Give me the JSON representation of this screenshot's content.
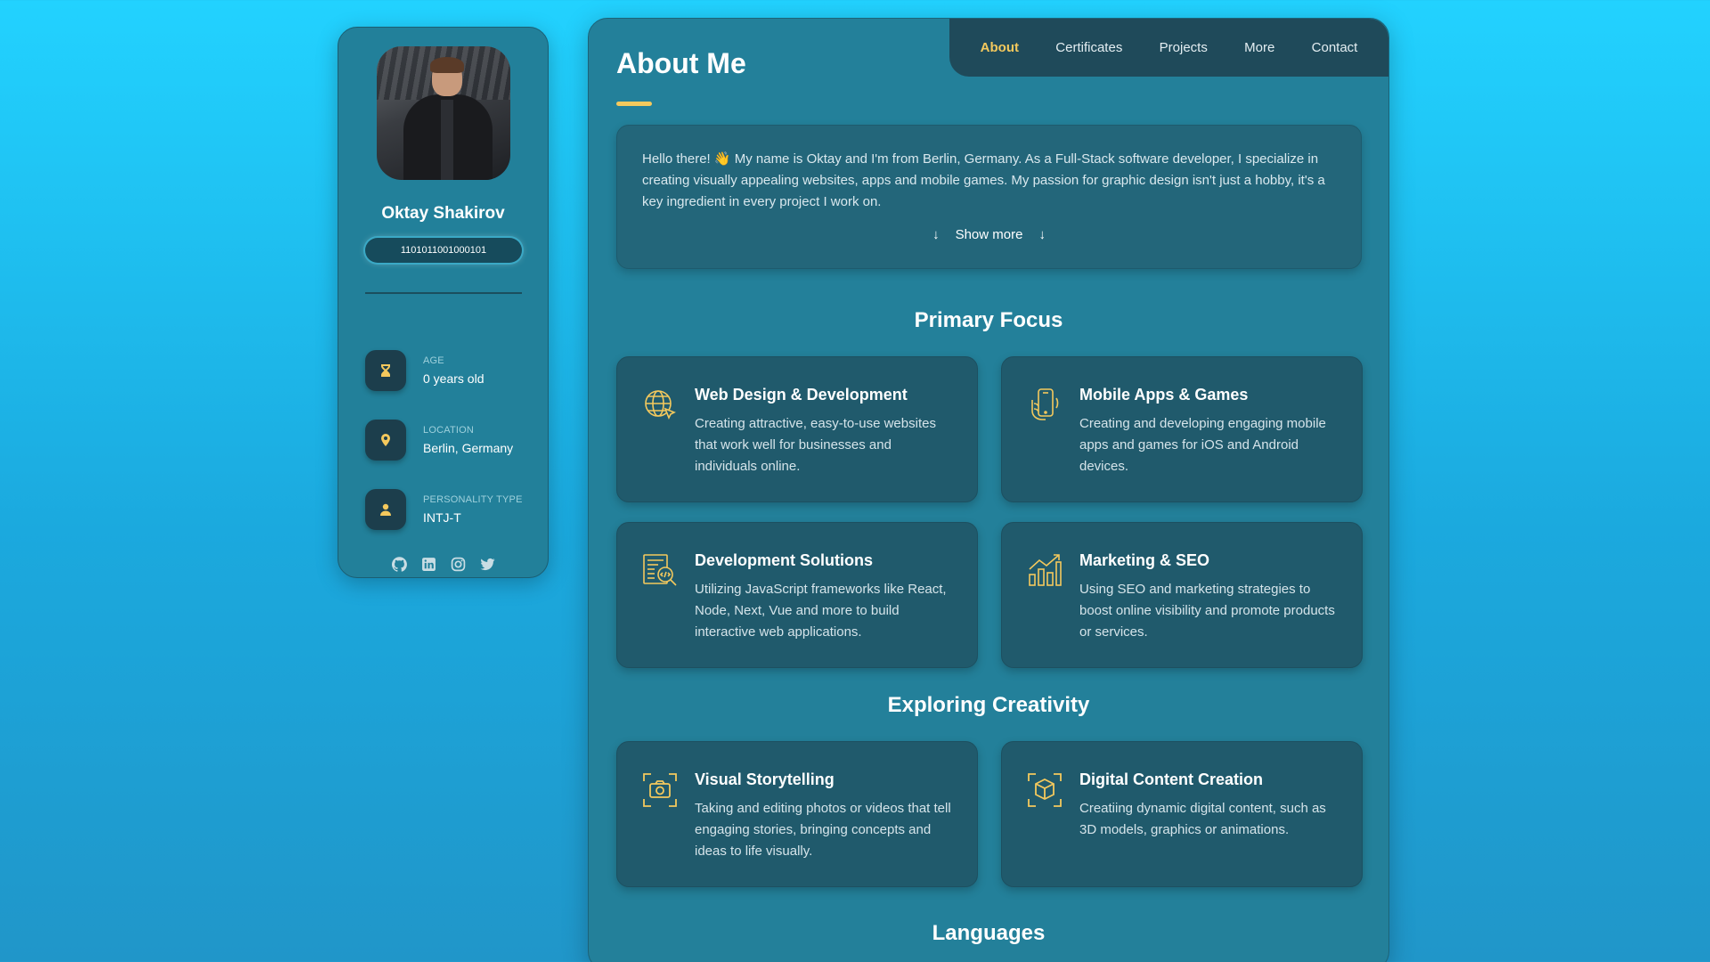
{
  "profile": {
    "name": "Oktay Shakirov",
    "binary": "1101011001000101",
    "info": [
      {
        "label": "Age",
        "value": "0 years old",
        "icon": "hourglass-icon"
      },
      {
        "label": "Location",
        "value": "Berlin, Germany",
        "icon": "location-pin-icon"
      },
      {
        "label": "Personality Type",
        "value": "INTJ-T",
        "icon": "person-icon"
      }
    ],
    "socials": [
      "github-icon",
      "linkedin-icon",
      "instagram-icon",
      "twitter-icon"
    ]
  },
  "nav": {
    "items": [
      "About",
      "Certificates",
      "Projects",
      "More",
      "Contact"
    ],
    "active": "About"
  },
  "about": {
    "title": "About Me",
    "intro": "Hello there! 👋 My name is Oktay and I'm from Berlin, Germany. As a Full-Stack software developer, I specialize in creating visually appealing websites, apps and mobile games. My passion for graphic design isn't just a hobby, it's a key ingredient in every project I work on.",
    "show_more": "Show more",
    "show_more_arrow": "↓"
  },
  "sections": {
    "primary_focus": "Primary Focus",
    "exploring_creativity": "Exploring Creativity",
    "languages": "Languages"
  },
  "cards": [
    {
      "title": "Web Design & Development",
      "desc": "Creating attractive, easy-to-use websites that work well for businesses and individuals online.",
      "icon": "globe-cursor-icon"
    },
    {
      "title": "Mobile Apps & Games",
      "desc": "Creating and developing engaging mobile apps and games for iOS and Android devices.",
      "icon": "mobile-hand-icon"
    },
    {
      "title": "Development Solutions",
      "desc": "Utilizing JavaScript frameworks like React, Node, Next, Vue and more to build interactive web applications.",
      "icon": "code-document-icon"
    },
    {
      "title": "Marketing & SEO",
      "desc": "Using SEO and marketing strategies to boost online visibility and promote products or services.",
      "icon": "bar-chart-growth-icon"
    },
    {
      "title": "Visual Storytelling",
      "desc": "Taking and editing photos or videos that tell engaging stories, bringing concepts and ideas to life visually.",
      "icon": "camera-frame-icon"
    },
    {
      "title": "Digital Content Creation",
      "desc": "Creatiing dynamic digital content, such as 3D models, graphics or animations.",
      "icon": "cube-frame-icon"
    }
  ],
  "colors": {
    "accent": "#f4c95d",
    "panel": "#23809a",
    "card": "#205a6c",
    "nav": "#1f4a5a"
  }
}
